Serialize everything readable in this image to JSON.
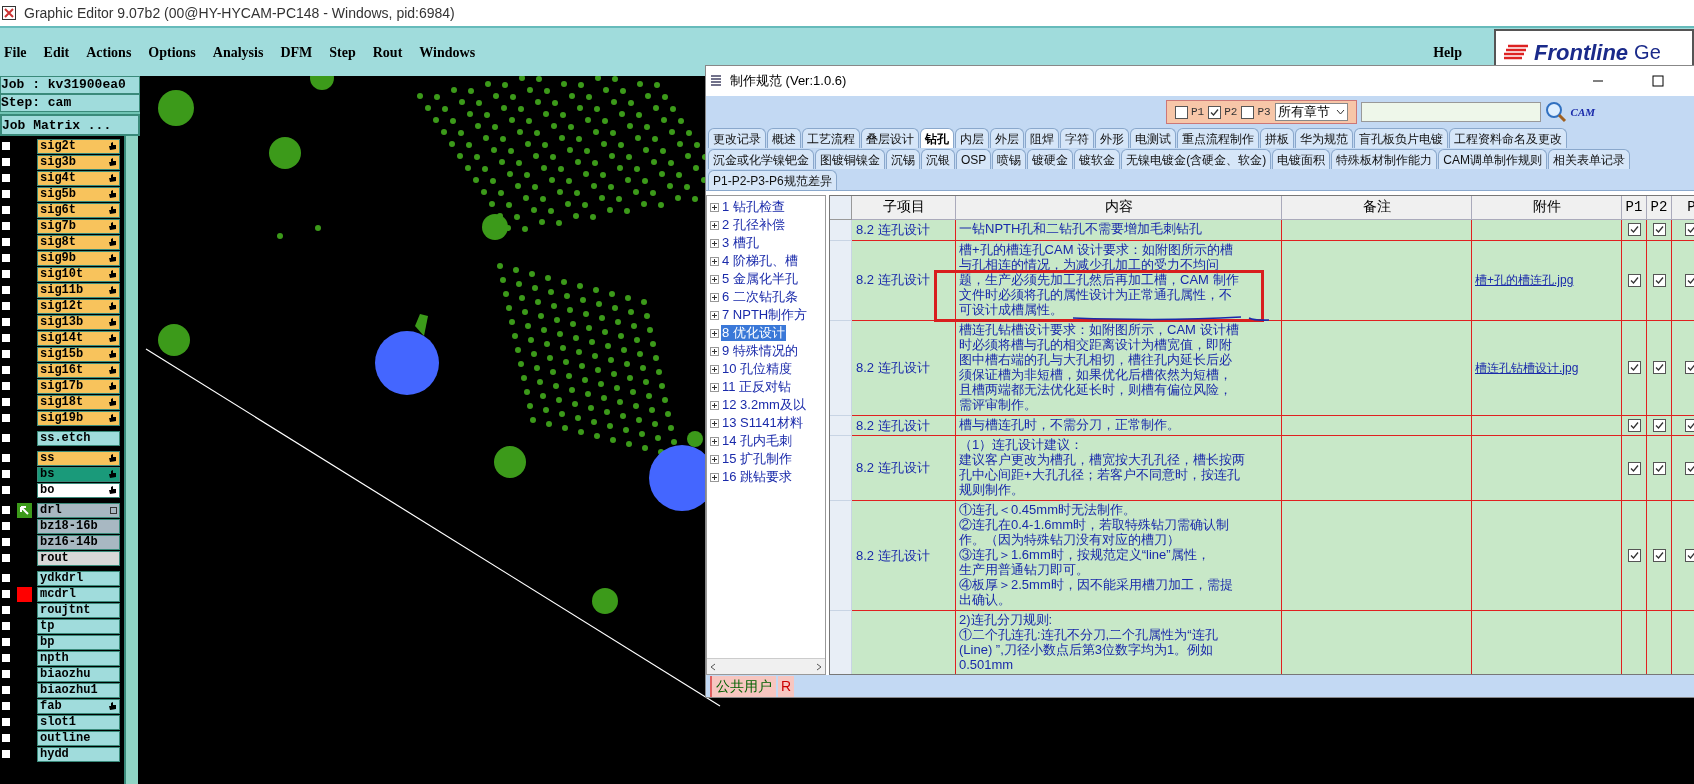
{
  "window": {
    "title": "Graphic Editor 9.07b2 (00@HY-HYCAM-PC148 - Windows, pid:6984)"
  },
  "menu": [
    "File",
    "Edit",
    "Actions",
    "Options",
    "Analysis",
    "DFM",
    "Step",
    "Rout",
    "Windows"
  ],
  "help": "Help",
  "logo": {
    "brand": "Frontline",
    "suffix": "Ge"
  },
  "job": {
    "job": "Job : kv31900ea0",
    "step": "Step: cam",
    "matrix_button": "Job Matrix ..."
  },
  "layer_groups": [
    {
      "layers": [
        {
          "name": "sig2t",
          "color": "#f8c35c",
          "hand": true,
          "checked": false
        },
        {
          "name": "sig3b",
          "color": "#f8c35c",
          "hand": true,
          "checked": false
        },
        {
          "name": "sig4t",
          "color": "#f8c35c",
          "hand": true,
          "checked": false
        },
        {
          "name": "sig5b",
          "color": "#f8c35c",
          "hand": true,
          "checked": false
        },
        {
          "name": "sig6t",
          "color": "#f8c35c",
          "hand": true,
          "checked": false
        },
        {
          "name": "sig7b",
          "color": "#f8c35c",
          "hand": true,
          "checked": false
        },
        {
          "name": "sig8t",
          "color": "#f8c35c",
          "hand": true,
          "checked": false
        },
        {
          "name": "sig9b",
          "color": "#f8c35c",
          "hand": true,
          "checked": false
        },
        {
          "name": "sig10t",
          "color": "#f8c35c",
          "hand": true,
          "checked": false
        },
        {
          "name": "sig11b",
          "color": "#f8c35c",
          "hand": true,
          "checked": false
        },
        {
          "name": "sig12t",
          "color": "#f8c35c",
          "hand": true,
          "checked": false
        },
        {
          "name": "sig13b",
          "color": "#f8c35c",
          "hand": true,
          "checked": false
        },
        {
          "name": "sig14t",
          "color": "#f8c35c",
          "hand": true,
          "checked": false
        },
        {
          "name": "sig15b",
          "color": "#f8c35c",
          "hand": true,
          "checked": false
        },
        {
          "name": "sig16t",
          "color": "#f8c35c",
          "hand": true,
          "checked": false
        },
        {
          "name": "sig17b",
          "color": "#f8c35c",
          "hand": true,
          "checked": false
        },
        {
          "name": "sig18t",
          "color": "#f8c35c",
          "hand": true,
          "checked": false
        },
        {
          "name": "sig19b",
          "color": "#f8c35c",
          "hand": true,
          "checked": false
        }
      ]
    },
    {
      "layers": [
        {
          "name": "ss.etch",
          "color": "#a0dcdc",
          "hand": false,
          "checked": false
        }
      ]
    },
    {
      "layers": [
        {
          "name": "ss",
          "color": "#f8c35c",
          "hand": true,
          "checked": false
        },
        {
          "name": "bs",
          "color": "#1a9a7a",
          "hand": true,
          "checked": false
        },
        {
          "name": "bo",
          "color": "#ffffff",
          "hand": true,
          "checked": false
        }
      ]
    },
    {
      "layers": [
        {
          "name": "drl",
          "color": "#a8b8c2",
          "hand": false,
          "checked": false,
          "kind": "arrow"
        },
        {
          "name": "bz18-16b",
          "color": "#a8b8c2",
          "hand": false,
          "checked": false
        },
        {
          "name": "bz16-14b",
          "color": "#a8b8c2",
          "hand": false,
          "checked": false
        },
        {
          "name": "rout",
          "color": "#d8d8d8",
          "hand": false,
          "checked": false
        }
      ]
    },
    {
      "layers": [
        {
          "name": "ydkdrl",
          "color": "#a0dcdc",
          "hand": false,
          "checked": false
        },
        {
          "name": "mcdrl",
          "color": "#a0dcdc",
          "hand": false,
          "checked": false,
          "kind": "flag"
        },
        {
          "name": "roujtnt",
          "color": "#a0dcdc",
          "hand": false,
          "checked": false
        },
        {
          "name": "tp",
          "color": "#a0dcdc",
          "hand": false,
          "checked": false
        },
        {
          "name": "bp",
          "color": "#a0dcdc",
          "hand": false,
          "checked": false
        },
        {
          "name": "npth",
          "color": "#a0dcdc",
          "hand": false,
          "checked": false
        },
        {
          "name": "biaozhu",
          "color": "#a0dcdc",
          "hand": false,
          "checked": false
        },
        {
          "name": "biaozhu1",
          "color": "#a0dcdc",
          "hand": false,
          "checked": false
        },
        {
          "name": "fab",
          "color": "#a0dcdc",
          "hand": true,
          "checked": false
        },
        {
          "name": "slot1",
          "color": "#a0dcdc",
          "hand": false,
          "checked": false
        },
        {
          "name": "outline",
          "color": "#a0dcdc",
          "hand": false,
          "checked": false
        },
        {
          "name": "hydd",
          "color": "#a0dcdc",
          "hand": false,
          "checked": false
        }
      ]
    }
  ],
  "dialog": {
    "title": "制作规范 (Ver:1.0.6)",
    "filters": [
      {
        "label": "P1",
        "checked": false
      },
      {
        "label": "P2",
        "checked": true
      },
      {
        "label": "P3",
        "checked": false
      }
    ],
    "chapter_select": "所有章节",
    "cam_logo": "CAM",
    "tab_rows": [
      [
        {
          "label": "更改记录",
          "selected": false
        },
        {
          "label": "概述",
          "selected": false
        },
        {
          "label": "工艺流程",
          "selected": false
        },
        {
          "label": "叠层设计",
          "selected": false
        },
        {
          "label": "钻孔",
          "selected": true
        },
        {
          "label": "内层",
          "selected": false
        },
        {
          "label": "外层",
          "selected": false
        },
        {
          "label": "阻焊",
          "selected": false
        },
        {
          "label": "字符",
          "selected": false
        },
        {
          "label": "外形",
          "selected": false
        },
        {
          "label": "电测试",
          "selected": false
        },
        {
          "label": "重点流程制作",
          "selected": false
        },
        {
          "label": "拼板",
          "selected": false
        },
        {
          "label": "华为规范",
          "selected": false
        },
        {
          "label": "盲孔板负片电镀",
          "selected": false
        },
        {
          "label": "工程资料命名及更改",
          "selected": false
        }
      ],
      [
        {
          "label": "沉金或化学镍钯金",
          "selected": false
        },
        {
          "label": "图镀铜镍金",
          "selected": false
        },
        {
          "label": "沉锡",
          "selected": false
        },
        {
          "label": "沉银",
          "selected": false
        },
        {
          "label": "OSP",
          "selected": false
        },
        {
          "label": "喷锡",
          "selected": false
        },
        {
          "label": "镀硬金",
          "selected": false
        },
        {
          "label": "镀软金",
          "selected": false
        },
        {
          "label": "无镍电镀金(含硬金、软金)",
          "selected": false
        },
        {
          "label": "电镀面积",
          "selected": false
        },
        {
          "label": "特殊板材制作能力",
          "selected": false
        },
        {
          "label": "CAM调单制作规则",
          "selected": false
        },
        {
          "label": "相关表单记录",
          "selected": false
        }
      ],
      [
        {
          "label": "P1-P2-P3-P6规范差异",
          "selected": false
        }
      ]
    ],
    "tree": [
      {
        "label": "1 钻孔检查",
        "selected": false
      },
      {
        "label": "2 孔径补偿",
        "selected": false
      },
      {
        "label": "3 槽孔",
        "selected": false
      },
      {
        "label": "4 阶梯孔、槽",
        "selected": false
      },
      {
        "label": "5 金属化半孔",
        "selected": false
      },
      {
        "label": "6 二次钻孔条",
        "selected": false
      },
      {
        "label": "7 NPTH制作方",
        "selected": false
      },
      {
        "label": "8 优化设计",
        "selected": true
      },
      {
        "label": "9 特殊情况的",
        "selected": false
      },
      {
        "label": "10 孔位精度",
        "selected": false
      },
      {
        "label": "11 正反对钻",
        "selected": false
      },
      {
        "label": "12 3.2mm及以",
        "selected": false
      },
      {
        "label": "13 S1141材料",
        "selected": false
      },
      {
        "label": "14 孔内毛刺",
        "selected": false
      },
      {
        "label": "15 扩孔制作",
        "selected": false
      },
      {
        "label": "16 跳钻要求",
        "selected": false
      }
    ],
    "table": {
      "columns": [
        "子项目",
        "内容",
        "备注",
        "附件",
        "P1",
        "P2",
        "P"
      ],
      "rows": [
        {
          "subitem": "8.2 连孔设计",
          "lines": [
            "一钻NPTH孔和二钻孔不需要增加毛刺钻孔"
          ],
          "p1": true,
          "p2": true,
          "p3": true
        },
        {
          "subitem": "8.2 连孔设计",
          "lines": [
            "槽+孔的槽连孔CAM 设计要求：如附图所示的槽",
            "与孔相连的情况，为减少孔加工的受力不均问",
            "题，生产必须先加工孔然后再加工槽，CAM 制作",
            "文件时必须将孔的属性设计为正常通孔属性，不",
            "可设计成槽属性。"
          ],
          "attachment": "槽+孔的槽连孔.jpg",
          "p1": true,
          "p2": true,
          "p3": true,
          "annotated": true
        },
        {
          "subitem": "8.2 连孔设计",
          "lines": [
            "槽连孔钻槽设计要求：如附图所示，CAM 设计槽",
            "时必须将槽与孔的相交距离设计为槽宽值，即附",
            "图中槽右端的孔与大孔相切，槽往孔内延长后必",
            "须保证槽为非短槽，如果优化后槽依然为短槽，",
            "且槽两端都无法优化延长时，则槽有偏位风险，",
            "需评审制作。"
          ],
          "attachment": "槽连孔钻槽设计.jpg",
          "p1": true,
          "p2": true,
          "p3": true
        },
        {
          "subitem": "8.2 连孔设计",
          "lines": [
            "槽与槽连孔时，不需分刀，正常制作。"
          ],
          "p1": true,
          "p2": true,
          "p3": true
        },
        {
          "subitem": "8.2 连孔设计",
          "lines": [
            "（1）连孔设计建议：",
            "建议客户更改为槽孔，槽宽按大孔孔径，槽长按两",
            "孔中心间距+大孔孔径；若客户不同意时，按连孔",
            "规则制作。"
          ],
          "p1": true,
          "p2": true,
          "p3": true
        },
        {
          "subitem": "8.2 连孔设计",
          "lines": [
            "①连孔＜0.45mm时无法制作。",
            "②连孔在0.4-1.6mm时，若取特殊钻刀需确认制",
            "作。（因为特殊钻刀没有对应的槽刀）",
            "③连孔＞1.6mm时，按规范定义“line”属性，",
            "生产用普通钻刀即可。",
            "④板厚＞2.5mm时，因不能采用槽刀加工，需提",
            "出确认。"
          ],
          "p1": true,
          "p2": true,
          "p3": true
        },
        {
          "lines": [
            "2)连孔分刀规则:",
            "①二个孔连孔:连孔不分刀,二个孔属性为“连孔",
            "(Line) ”,刀径小数点后第3位数字均为1。例如",
            "0.501mm"
          ]
        }
      ]
    },
    "status": {
      "user": "公共用户",
      "mode": "R"
    }
  }
}
